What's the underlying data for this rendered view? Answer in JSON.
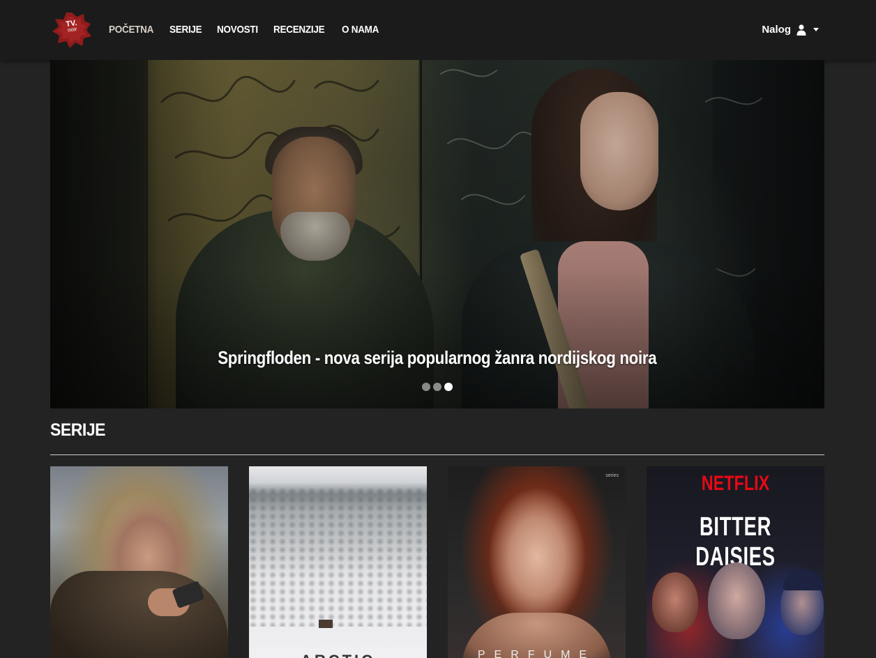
{
  "brand": {
    "logo_main": "TV.",
    "logo_sub": "noir",
    "color": "#8f1b1b"
  },
  "nav": {
    "items": [
      {
        "label": "POČETNA",
        "active": true
      },
      {
        "label": "SERIJE",
        "active": false
      },
      {
        "label": "NOVOSTI",
        "active": false
      },
      {
        "label": "RECENZIJE",
        "active": false
      },
      {
        "label": "O NAMA",
        "active": false
      }
    ],
    "account_label": "Nalog",
    "account_icon": "user-icon"
  },
  "hero": {
    "caption": "Springfloden - nova serija popularnog žanra nordijskog noira",
    "slides_count": 3,
    "active_slide": 3
  },
  "section": {
    "title": "SERIJE"
  },
  "series_cards": [
    {
      "overlay_text": ""
    },
    {
      "overlay_text": "ARCTIC"
    },
    {
      "brand_text": "series",
      "overlay_text": "PERFUME"
    },
    {
      "brand_text": "NETFLIX",
      "overlay_text": "BITTER DAISIES"
    }
  ]
}
